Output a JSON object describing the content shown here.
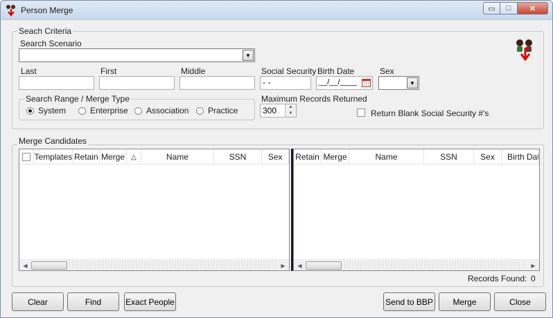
{
  "window": {
    "title": "Person Merge",
    "min_glyph": "▭",
    "max_glyph": "□",
    "close_glyph": "✕"
  },
  "search_criteria": {
    "legend": "Seach Criteria",
    "scenario_label": "Search Scenario",
    "last_label": "Last",
    "first_label": "First",
    "middle_label": "Middle",
    "ssn_label": "Social Security",
    "ssn_value": " - -",
    "birth_label": "Birth Date",
    "birth_value": "__/__/____",
    "sex_label": "Sex",
    "range_legend": "Search Range / Merge Type",
    "range_options": [
      "System",
      "Enterprise",
      "Association",
      "Practice"
    ],
    "range_selected": "System",
    "max_label": "Maximum Records Returned",
    "max_value": "300",
    "blank_ssn_label": "Return Blank Social Security #'s"
  },
  "merge_candidates": {
    "legend": "Merge Candidates",
    "left_columns": [
      "Templates",
      "Retain",
      "Merge",
      "△",
      "Name",
      "SSN",
      "Sex"
    ],
    "right_columns": [
      "Retain",
      "Merge",
      "Name",
      "SSN",
      "Sex",
      "Birth Date"
    ],
    "records_found_label": "Records Found:",
    "records_found_value": "0"
  },
  "buttons": {
    "clear": "Clear",
    "find": "Find",
    "exact": "Exact People",
    "send": "Send to BBP",
    "merge": "Merge",
    "close": "Close"
  },
  "colors": {
    "accent_red": "#e00000",
    "title_bar": "#c9d9ec"
  }
}
